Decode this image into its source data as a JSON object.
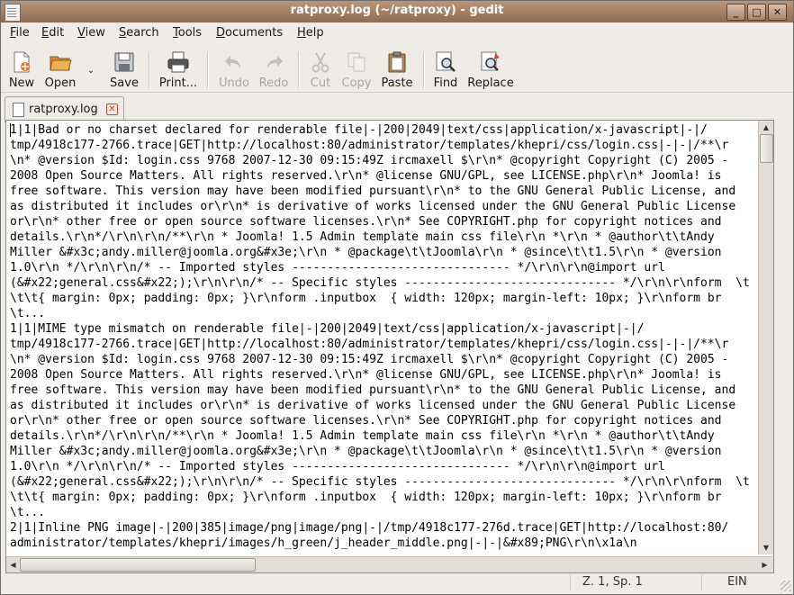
{
  "window": {
    "title": "ratproxy.log (~/ratproxy) - gedit",
    "controls": [
      "minimize",
      "maximize",
      "close"
    ]
  },
  "menubar": [
    {
      "label": "File",
      "mnemonic_index": 0
    },
    {
      "label": "Edit",
      "mnemonic_index": 0
    },
    {
      "label": "View",
      "mnemonic_index": 0
    },
    {
      "label": "Search",
      "mnemonic_index": 0
    },
    {
      "label": "Tools",
      "mnemonic_index": 0
    },
    {
      "label": "Documents",
      "mnemonic_index": 0
    },
    {
      "label": "Help",
      "mnemonic_index": 0
    }
  ],
  "toolbar": {
    "new": "New",
    "open": "Open",
    "save": "Save",
    "print": "Print...",
    "undo": "Undo",
    "redo": "Redo",
    "cut": "Cut",
    "copy": "Copy",
    "paste": "Paste",
    "find": "Find",
    "replace": "Replace"
  },
  "tab": {
    "label": "ratproxy.log"
  },
  "editor": {
    "lines": [
      "1|1|Bad or no charset declared for renderable file|-|200|2049|text/css|application/x-javascript|-|/",
      "tmp/4918c177-2766.trace|GET|http://localhost:80/administrator/templates/khepri/css/login.css|-|-|/**\\r",
      "\\n* @version $Id: login.css 9768 2007-12-30 09:15:49Z ircmaxell $\\r\\n* @copyright Copyright (C) 2005 -",
      "2008 Open Source Matters. All rights reserved.\\r\\n* @license GNU/GPL, see LICENSE.php\\r\\n* Joomla! is",
      "free software. This version may have been modified pursuant\\r\\n* to the GNU General Public License, and",
      "as distributed it includes or\\r\\n* is derivative of works licensed under the GNU General Public License",
      "or\\r\\n* other free or open source software licenses.\\r\\n* See COPYRIGHT.php for copyright notices and",
      "details.\\r\\n*/\\r\\n\\r\\n/**\\r\\n * Joomla! 1.5 Admin template main css file\\r\\n *\\r\\n * @author\\t\\tAndy",
      "Miller &#x3c;andy.miller@joomla.org&#x3e;\\r\\n * @package\\t\\tJoomla\\r\\n * @since\\t\\t1.5\\r\\n * @version",
      "1.0\\r\\n */\\r\\n\\r\\n/* -- Imported styles ------------------------------- */\\r\\n\\r\\n@import url",
      "(&#x22;general.css&#x22;);\\r\\n\\r\\n/* -- Specific styles ------------------------------ */\\r\\n\\r\\nform  \\t",
      "\\t\\t{ margin: 0px; padding: 0px; }\\r\\nform .inputbox  { width: 120px; margin-left: 10px; }\\r\\nform br",
      "\\t...",
      "1|1|MIME type mismatch on renderable file|-|200|2049|text/css|application/x-javascript|-|/",
      "tmp/4918c177-2766.trace|GET|http://localhost:80/administrator/templates/khepri/css/login.css|-|-|/**\\r",
      "\\n* @version $Id: login.css 9768 2007-12-30 09:15:49Z ircmaxell $\\r\\n* @copyright Copyright (C) 2005 -",
      "2008 Open Source Matters. All rights reserved.\\r\\n* @license GNU/GPL, see LICENSE.php\\r\\n* Joomla! is",
      "free software. This version may have been modified pursuant\\r\\n* to the GNU General Public License, and",
      "as distributed it includes or\\r\\n* is derivative of works licensed under the GNU General Public License",
      "or\\r\\n* other free or open source software licenses.\\r\\n* See COPYRIGHT.php for copyright notices and",
      "details.\\r\\n*/\\r\\n\\r\\n/**\\r\\n * Joomla! 1.5 Admin template main css file\\r\\n *\\r\\n * @author\\t\\tAndy",
      "Miller &#x3c;andy.miller@joomla.org&#x3e;\\r\\n * @package\\t\\tJoomla\\r\\n * @since\\t\\t1.5\\r\\n * @version",
      "1.0\\r\\n */\\r\\n\\r\\n/* -- Imported styles ------------------------------- */\\r\\n\\r\\n@import url",
      "(&#x22;general.css&#x22;);\\r\\n\\r\\n/* -- Specific styles ------------------------------ */\\r\\n\\r\\nform  \\t",
      "\\t\\t{ margin: 0px; padding: 0px; }\\r\\nform .inputbox  { width: 120px; margin-left: 10px; }\\r\\nform br",
      "\\t...",
      "2|1|Inline PNG image|-|200|385|image/png|image/png|-|/tmp/4918c177-276d.trace|GET|http://localhost:80/",
      "administrator/templates/khepri/images/h_green/j_header_middle.png|-|-|&#x89;PNG\\r\\n\\x1a\\n"
    ]
  },
  "statusbar": {
    "position": "Z. 1, Sp. 1",
    "insert_mode": "EIN"
  },
  "colors": {
    "titlebar": "#9a7558",
    "background": "#efebe7",
    "close_tab": "#d0452f",
    "open_icon": "#e8a040",
    "new_icon_badge": "#f06a1a"
  }
}
